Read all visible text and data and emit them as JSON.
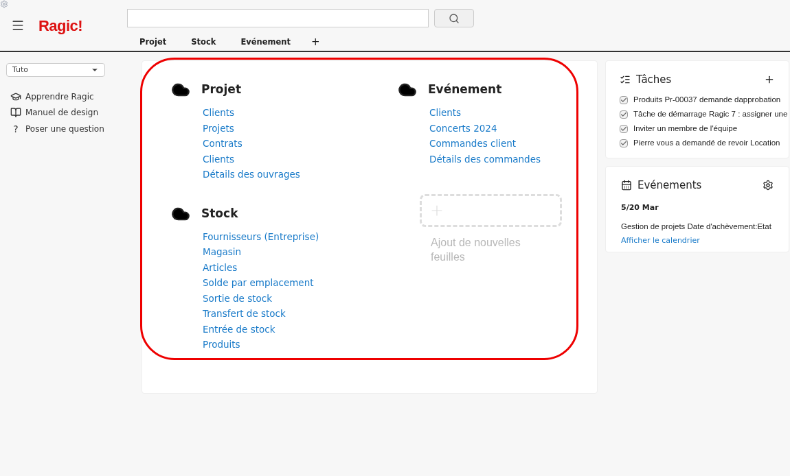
{
  "header": {
    "logo": "Ragic!",
    "tabs": [
      {
        "label": "Projet",
        "selected": false
      },
      {
        "label": "Stock",
        "selected": false
      },
      {
        "label": "Evénement",
        "selected": false
      }
    ],
    "add_tab": "+"
  },
  "sidebar": {
    "account_select": "Tuto",
    "items": [
      {
        "kind": "learn",
        "label": "Apprendre Ragic"
      },
      {
        "kind": "manual",
        "label": "Manuel de design"
      },
      {
        "kind": "question",
        "icon": "?",
        "label": "Poser une question"
      }
    ]
  },
  "tabs_columns": [
    [
      {
        "title": "Projet",
        "sheets": [
          "Clients",
          "Projets",
          "Contrats",
          "Clients",
          "Détails des ouvrages"
        ]
      },
      {
        "title": "Stock",
        "sheets": [
          "Fournisseurs (Entreprise)",
          "Magasin",
          "Articles",
          "Solde par emplacement",
          "Sortie de stock",
          "Transfert de stock",
          "Entrée de stock",
          "Produits"
        ]
      }
    ],
    [
      {
        "title": "Evénement",
        "sheets": [
          "Clients",
          "Concerts 2024",
          "Commandes client",
          "Détails des commandes"
        ]
      }
    ]
  ],
  "add_sheet": {
    "label": "Ajout de nouvelles feuilles"
  },
  "tasks": {
    "title": "Tâches",
    "items": [
      {
        "label": "Produits Pr-00037 demande dapprobation",
        "checked": true
      },
      {
        "label": "Tâche de démarrage Ragic 7 : assigner une",
        "checked": true
      },
      {
        "label": "Inviter un membre de l'équipe",
        "checked": true
      },
      {
        "label": "Pierre vous a demandé de revoir Location",
        "checked": true
      }
    ]
  },
  "events": {
    "title": "Evénements",
    "date": "5/20 Mar",
    "entry": "Gestion de projets Date d'achèvement:Etat",
    "link": "Afficher le calendrier"
  }
}
